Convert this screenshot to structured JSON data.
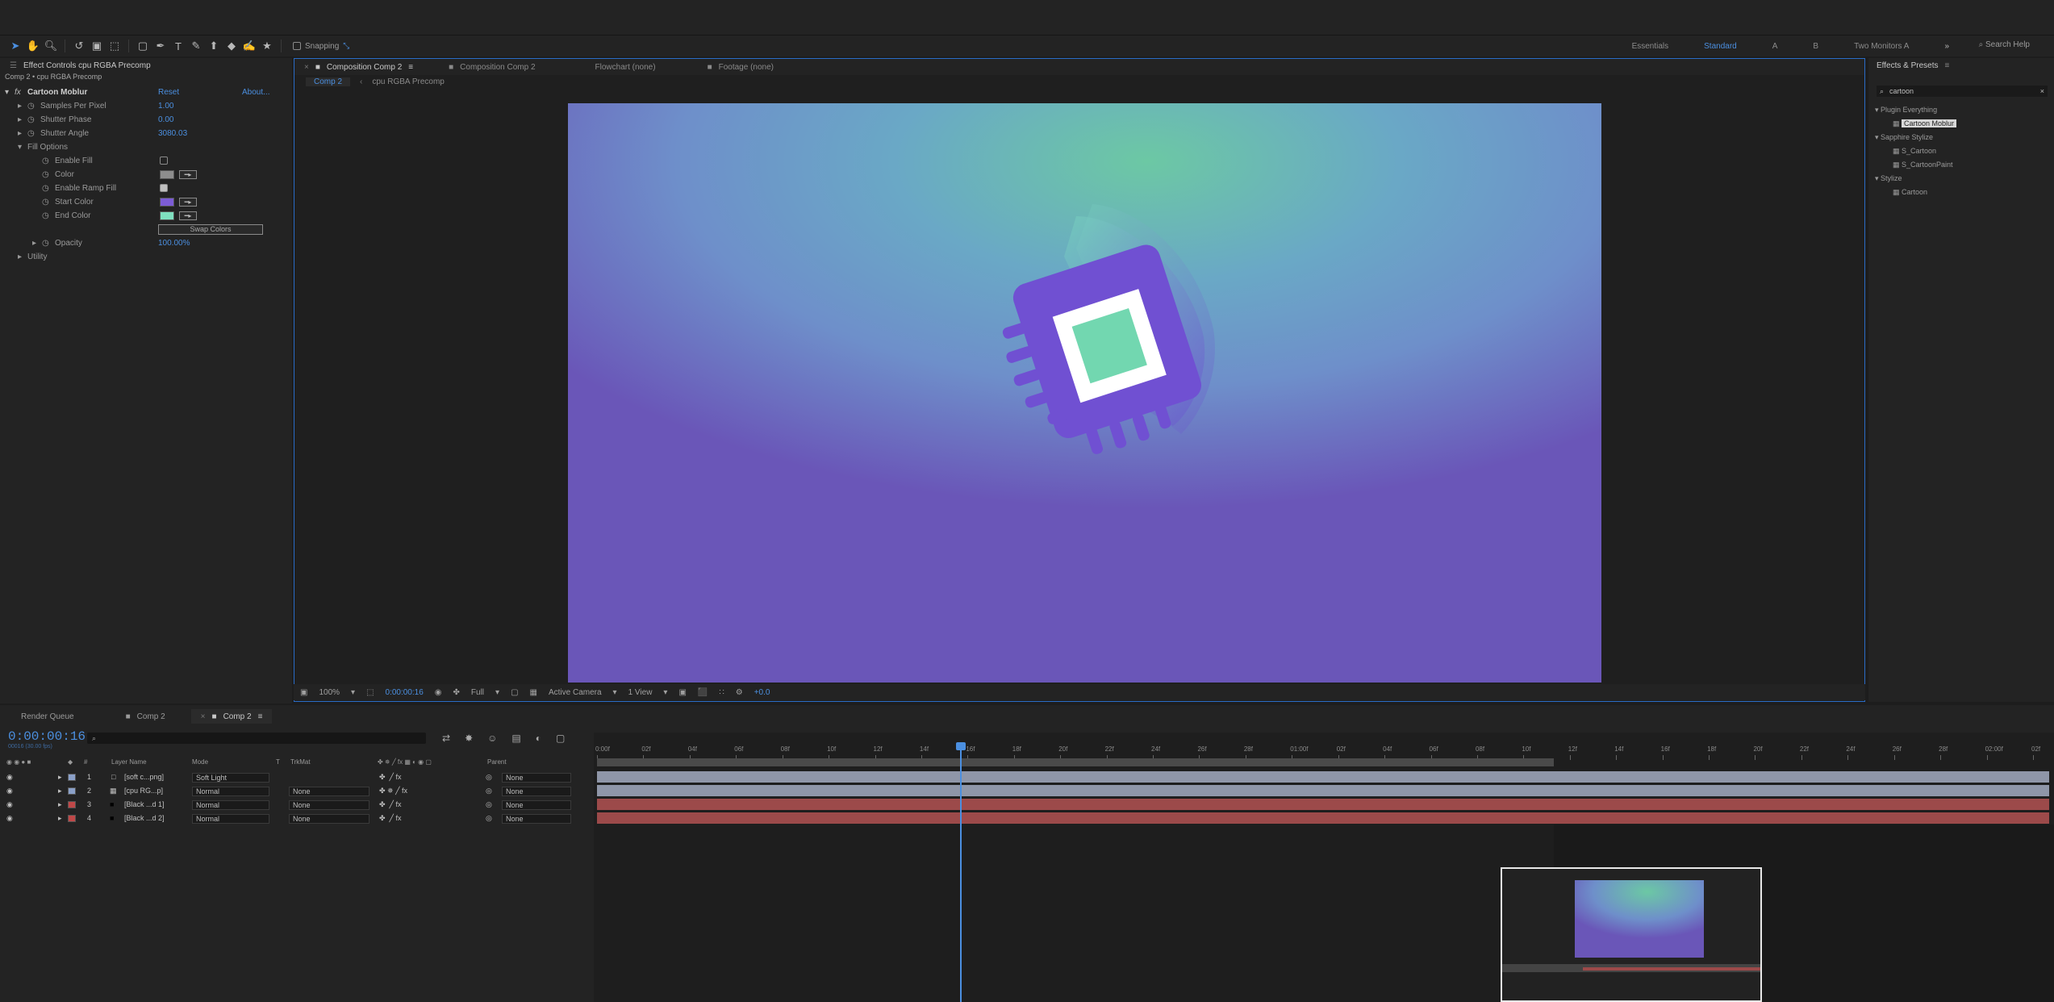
{
  "toolbar": {
    "tools": [
      "selection-tool",
      "hand-tool",
      "zoom-tool",
      "rotate-tool",
      "camera-tool",
      "pan-behind-tool",
      "shape-tool",
      "pen-tool",
      "type-tool",
      "brush-tool",
      "clone-stamp-tool",
      "eraser-tool",
      "roto-brush-tool",
      "puppet-tool"
    ],
    "snapping_label": "Snapping",
    "workspaces": [
      "Essentials",
      "Standard",
      "A",
      "B",
      "Two Monitors A"
    ],
    "active_workspace": "Standard",
    "search_help": "Search Help"
  },
  "effect_controls": {
    "tab_label": "Effect Controls cpu RGBA Precomp",
    "breadcrumb": "Comp 2 • cpu RGBA Precomp",
    "effect_name": "Cartoon Moblur",
    "reset_label": "Reset",
    "about_label": "About...",
    "params": [
      {
        "label": "Samples Per Pixel",
        "value": "1.00"
      },
      {
        "label": "Shutter Phase",
        "value": "0.00"
      },
      {
        "label": "Shutter Angle",
        "value": "3080.03"
      }
    ],
    "fill_options_label": "Fill Options",
    "fill_params": [
      {
        "label": "Enable Fill"
      },
      {
        "label": "Color"
      },
      {
        "label": "Enable Ramp Fill"
      },
      {
        "label": "Start Color"
      },
      {
        "label": "End Color"
      }
    ],
    "swap_colors_label": "Swap Colors",
    "opacity_label": "Opacity",
    "opacity_value": "100.00%",
    "utility_label": "Utility",
    "colors": {
      "color": "#8d8d8d",
      "start": "#7c5cd6",
      "end": "#7fe0c0"
    }
  },
  "viewer": {
    "tabs": [
      "Composition Comp 2",
      "Composition Comp 2",
      "Flowchart (none)",
      "Footage (none)"
    ],
    "sub_tabs": [
      "Comp 2",
      "cpu RGBA Precomp"
    ],
    "zoom": "100%",
    "timecode": "0:00:00:16",
    "resolution": "Full",
    "camera": "Active Camera",
    "views": "1 View",
    "exposure": "+0.0"
  },
  "presets": {
    "tab_label": "Effects & Presets",
    "search_value": "cartoon",
    "tree": [
      {
        "group": "Plugin Everything",
        "items": [
          "Cartoon Moblur"
        ]
      },
      {
        "group": "Sapphire Stylize",
        "items": [
          "S_Cartoon",
          "S_CartoonPaint"
        ]
      },
      {
        "group": "Stylize",
        "items": [
          "Cartoon"
        ]
      }
    ]
  },
  "timeline": {
    "tabs": [
      "Render Queue",
      "Comp 2",
      "Comp 2"
    ],
    "timecode": "0:00:00:16",
    "timecode_sub": "00016 (30.00 fps)",
    "search_placeholder": "",
    "columns": [
      "#",
      "Layer Name",
      "Mode",
      "T",
      "TrkMat",
      "Parent"
    ],
    "layers": [
      {
        "num": "1",
        "name": "[soft c...png]",
        "mode": "Soft Light",
        "trkmat": "",
        "parent": "None",
        "color": "#8aa0c8"
      },
      {
        "num": "2",
        "name": "[cpu RG...p]",
        "mode": "Normal",
        "trkmat": "None",
        "parent": "None",
        "color": "#8aa0c8"
      },
      {
        "num": "3",
        "name": "[Black ...d 1]",
        "mode": "Normal",
        "trkmat": "None",
        "parent": "None",
        "color": "#c04848"
      },
      {
        "num": "4",
        "name": "[Black ...d 2]",
        "mode": "Normal",
        "trkmat": "None",
        "parent": "None",
        "color": "#c04848"
      }
    ],
    "ruler": [
      "0:00f",
      "02f",
      "04f",
      "06f",
      "08f",
      "10f",
      "12f",
      "14f",
      "16f",
      "18f",
      "20f",
      "22f",
      "24f",
      "26f",
      "28f",
      "01:00f",
      "02f",
      "04f",
      "06f",
      "08f",
      "10f",
      "12f",
      "14f",
      "16f",
      "18f",
      "20f",
      "22f",
      "24f",
      "26f",
      "28f",
      "02:00f",
      "02f"
    ]
  }
}
